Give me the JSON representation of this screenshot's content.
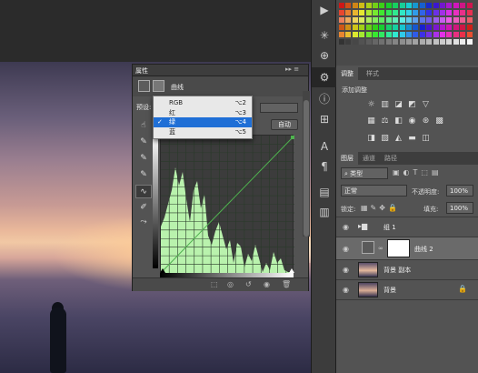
{
  "properties": {
    "tab_label": "属性",
    "panel_title": "曲线",
    "preset_label": "预设:",
    "auto_label": "自动",
    "channel_menu": [
      {
        "label": "RGB",
        "shortcut": "⌥2",
        "selected": false
      },
      {
        "label": "红",
        "shortcut": "⌥3",
        "selected": false
      },
      {
        "label": "绿",
        "shortcut": "⌥4",
        "selected": true
      },
      {
        "label": "蓝",
        "shortcut": "⌥5",
        "selected": false
      }
    ],
    "checkmark": "✓",
    "graph_colors": {
      "histogram": "#b9f2ad",
      "curve": "#4fb24f",
      "grid": "#2a3a2a"
    }
  },
  "adjustments": {
    "tabs": [
      "调整",
      "样式"
    ],
    "title": "添加调整"
  },
  "layers": {
    "tabs": [
      "图层",
      "通道",
      "路径"
    ],
    "filter_label": "类型",
    "blend_mode": "正常",
    "opacity_label": "不透明度:",
    "opacity_value": "100%",
    "lock_label": "锁定:",
    "fill_label": "填充:",
    "fill_value": "100%",
    "items": [
      {
        "name": "组 1",
        "kind": "group"
      },
      {
        "name": "曲线 2",
        "kind": "adjustment"
      },
      {
        "name": "背景 副本",
        "kind": "image"
      },
      {
        "name": "背景",
        "kind": "image"
      }
    ]
  }
}
